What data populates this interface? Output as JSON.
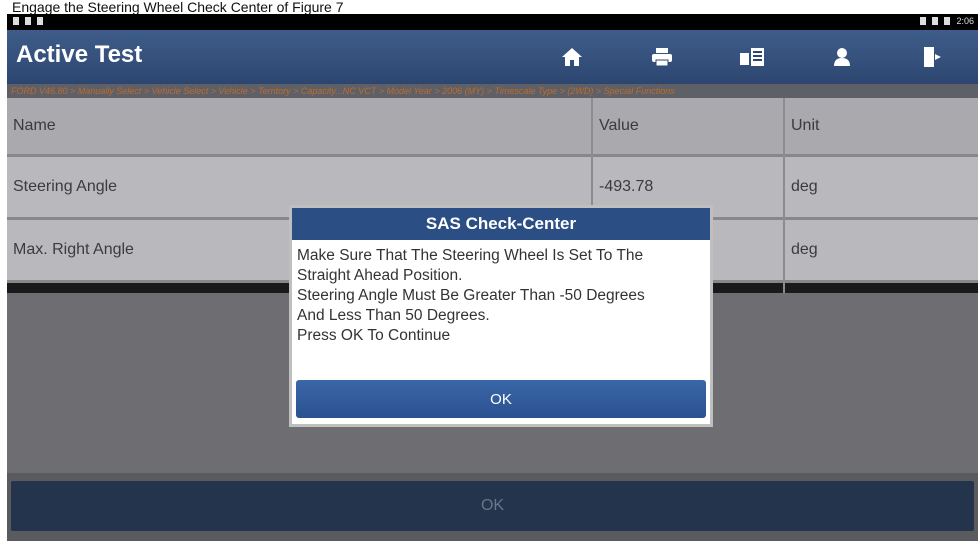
{
  "caption": "Engage the Steering Wheel Check Center of Figure 7",
  "app": {
    "title": "Active Test"
  },
  "toolbar": {
    "icons": [
      "home-icon",
      "print-icon",
      "report-icon",
      "user-icon",
      "exit-icon"
    ]
  },
  "breadcrumb": "FORD V46.80 > Manually Select > Vehicle Select > Vehicle > Territory > Capacity...NC VCT > Model Year > 2006 (MY) > Timescale Type > (2WD) > Special Functions",
  "table": {
    "columns": [
      "Name",
      "Value",
      "Unit"
    ],
    "rows": [
      {
        "name": "Steering Angle",
        "value": "-493.78",
        "unit": "deg"
      },
      {
        "name": "Max. Right Angle",
        "value": "",
        "unit": "deg"
      }
    ]
  },
  "dialog": {
    "title": "SAS Check-Center",
    "lines": [
      "Make Sure That The Steering Wheel Is Set To The",
      "Straight Ahead Position.",
      "Steering Angle Must Be Greater Than -50 Degrees",
      "And Less Than 50 Degrees.",
      "Press OK To Continue"
    ],
    "ok_label": "OK"
  },
  "footer": {
    "ok_label": "OK"
  },
  "status": {
    "time": "2:06"
  }
}
